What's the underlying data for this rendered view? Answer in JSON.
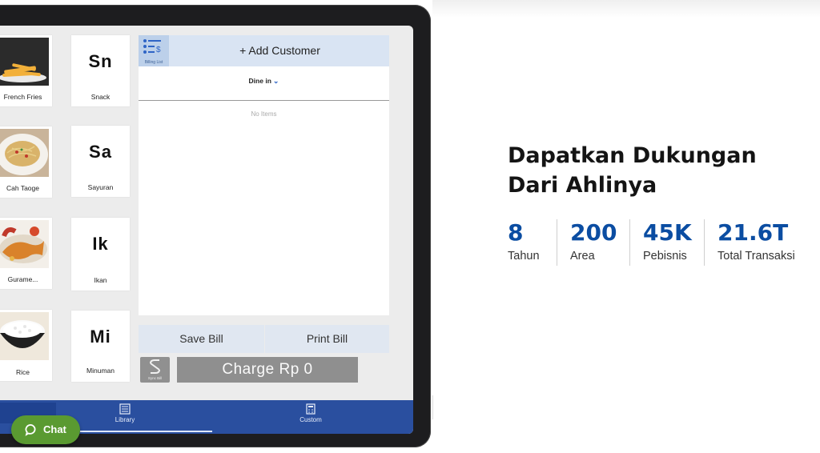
{
  "products": [
    {
      "name": "French Fries",
      "image": "fries"
    },
    {
      "name": "Cah Taoge",
      "image": "noodles"
    },
    {
      "name": "Gurame...",
      "image": "fish"
    },
    {
      "name": "Rice",
      "image": "rice"
    }
  ],
  "categories": [
    {
      "abbr": "Sn",
      "name": "Snack"
    },
    {
      "abbr": "Sa",
      "name": "Sayuran"
    },
    {
      "abbr": "Ik",
      "name": "Ikan"
    },
    {
      "abbr": "Mi",
      "name": "Minuman"
    }
  ],
  "billing": {
    "billing_list_label": "Billing List",
    "add_customer": "+ Add Customer",
    "order_type": "Dine in",
    "empty_text": "No Items",
    "save_bill": "Save Bill",
    "print_bill": "Print Bill",
    "sync_label": "Sync Bill",
    "charge": "Charge Rp 0"
  },
  "nav": {
    "library": "Library",
    "custom": "Custom"
  },
  "chat": {
    "label": "Chat"
  },
  "headline": {
    "line1": "Dapatkan Dukungan",
    "line2": "Dari Ahlinya"
  },
  "stats": [
    {
      "value": "8",
      "label": "Tahun"
    },
    {
      "value": "200",
      "label": "Area"
    },
    {
      "value": "45K",
      "label": "Pebisnis"
    },
    {
      "value": "21.6T",
      "label": "Total Transaksi"
    }
  ],
  "colors": {
    "accent_blue": "#0b4da2",
    "nav_blue": "#2a4f9f",
    "chat_green": "#5a9a31"
  }
}
